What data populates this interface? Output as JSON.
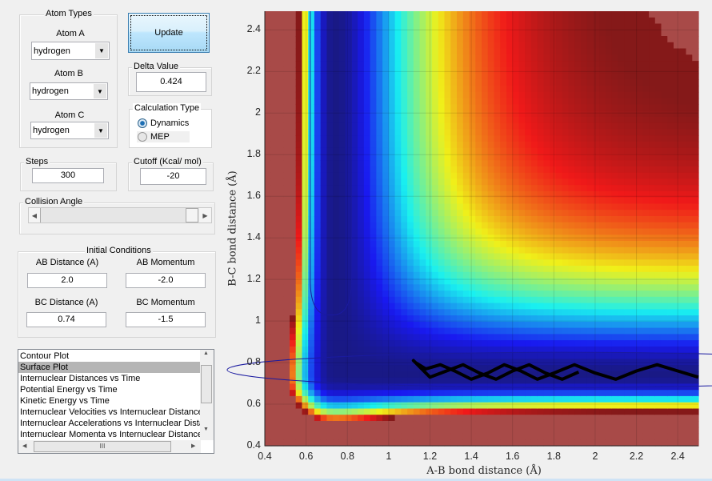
{
  "atom_types": {
    "title": "Atom Types",
    "atom_a": {
      "label": "Atom A",
      "value": "hydrogen"
    },
    "atom_b": {
      "label": "Atom B",
      "value": "hydrogen"
    },
    "atom_c": {
      "label": "Atom C",
      "value": "hydrogen"
    }
  },
  "update_label": "Update",
  "delta": {
    "title": "Delta Value",
    "value": "0.424"
  },
  "calc_type": {
    "title": "Calculation Type",
    "options": [
      "Dynamics",
      "MEP"
    ],
    "selected": "Dynamics"
  },
  "steps": {
    "title": "Steps",
    "value": "300"
  },
  "cutoff": {
    "title": "Cutoff (Kcal/ mol)",
    "value": "-20"
  },
  "collision_angle": {
    "title": "Collision Angle",
    "value_fraction": 1.0
  },
  "initial": {
    "title": "Initial Conditions",
    "ab_distance": {
      "label": "AB Distance (A)",
      "value": "2.0"
    },
    "ab_momentum": {
      "label": "AB Momentum",
      "value": "-2.0"
    },
    "bc_distance": {
      "label": "BC Distance (A)",
      "value": "0.74"
    },
    "bc_momentum": {
      "label": "BC Momentum",
      "value": "-1.5"
    }
  },
  "plot_list": {
    "items": [
      "Contour Plot",
      "Surface Plot",
      "Internuclear Distances vs Time",
      "Potential Energy vs Time",
      "Kinetic Energy vs Time",
      "Internuclear Velocities vs Internuclear Distance",
      "Internuclear Accelerations vs Internuclear Distance",
      "Internuclear Momenta vs Internuclear Distance"
    ],
    "selected": "Surface Plot",
    "scroll_grip": "III"
  },
  "chart_data": {
    "type": "heatmap",
    "title": "",
    "xlabel": "A-B bond distance (Å)",
    "ylabel": "B-C bond distance (Å)",
    "xlim": [
      0.4,
      2.5
    ],
    "ylim": [
      0.4,
      2.5
    ],
    "xticks": [
      "0.4",
      "0.6",
      "0.8",
      "1",
      "1.2",
      "1.4",
      "1.6",
      "1.8",
      "2",
      "2.2",
      "2.4"
    ],
    "yticks": [
      "0.4",
      "0.6",
      "0.8",
      "1",
      "1.2",
      "1.4",
      "1.6",
      "1.8",
      "2",
      "2.2",
      "2.4"
    ],
    "colormap": "jet",
    "grid": true,
    "cutoff_color": "#a84a48",
    "trajectory_color": "#000000",
    "trajectory": [
      [
        2.5,
        0.73
      ],
      [
        2.4,
        0.76
      ],
      [
        2.3,
        0.79
      ],
      [
        2.2,
        0.76
      ],
      [
        2.1,
        0.72
      ],
      [
        2.0,
        0.75
      ],
      [
        1.9,
        0.79
      ],
      [
        1.8,
        0.75
      ],
      [
        1.72,
        0.72
      ],
      [
        1.64,
        0.76
      ],
      [
        1.56,
        0.79
      ],
      [
        1.48,
        0.75
      ],
      [
        1.4,
        0.72
      ],
      [
        1.32,
        0.76
      ],
      [
        1.25,
        0.79
      ],
      [
        1.18,
        0.77
      ],
      [
        1.13,
        0.8
      ],
      [
        1.12,
        0.81
      ],
      [
        1.15,
        0.78
      ],
      [
        1.2,
        0.73
      ],
      [
        1.28,
        0.76
      ],
      [
        1.36,
        0.79
      ],
      [
        1.44,
        0.75
      ],
      [
        1.52,
        0.72
      ],
      [
        1.6,
        0.76
      ],
      [
        1.68,
        0.79
      ],
      [
        1.76,
        0.75
      ],
      [
        1.84,
        0.72
      ],
      [
        1.92,
        0.755
      ]
    ]
  }
}
